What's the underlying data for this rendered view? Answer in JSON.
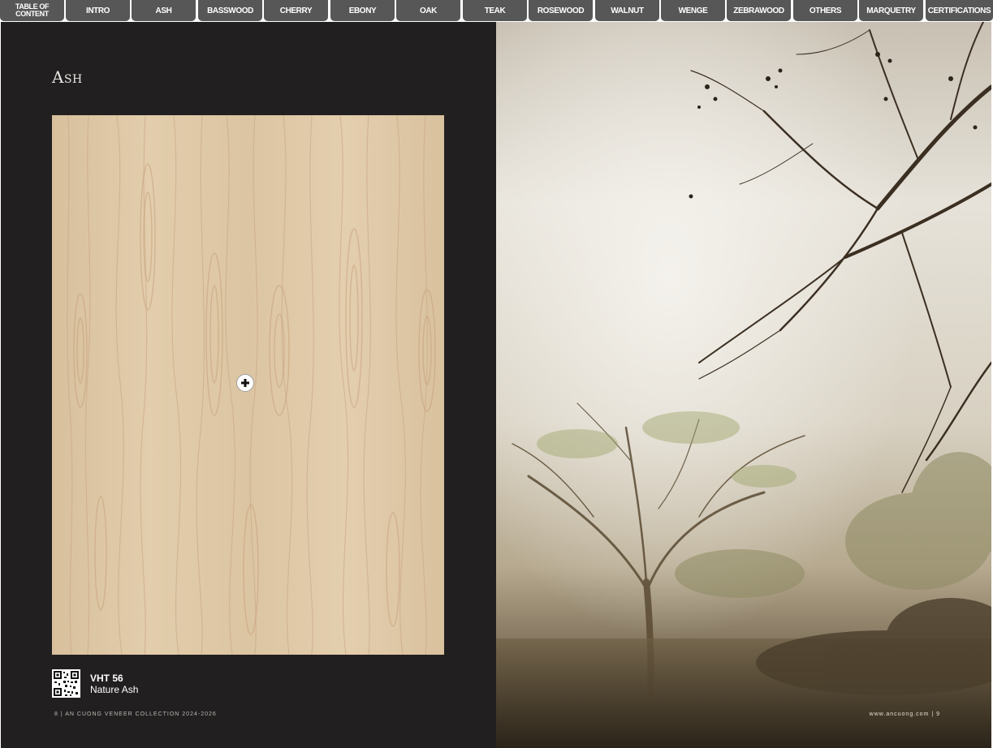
{
  "tabs": [
    {
      "label": "TABLE OF CONTENT"
    },
    {
      "label": "INTRO"
    },
    {
      "label": "ASH"
    },
    {
      "label": "BASSWOOD"
    },
    {
      "label": "CHERRY"
    },
    {
      "label": "EBONY"
    },
    {
      "label": "OAK"
    },
    {
      "label": "TEAK"
    },
    {
      "label": "ROSEWOOD"
    },
    {
      "label": "WALNUT"
    },
    {
      "label": "WENGE"
    },
    {
      "label": "ZEBRAWOOD"
    },
    {
      "label": "OTHERS"
    },
    {
      "label": "MARQUETRY"
    },
    {
      "label": "CERTIFICATIONS"
    }
  ],
  "left_page": {
    "section_title": "Ash",
    "product": {
      "code": "VHT 56",
      "name": "Nature Ash"
    },
    "footer": "8 | AN CUONG VENEER COLLECTION 2024-2026",
    "zoom_icon": "plus-icon",
    "qr_icon": "qr-code-icon"
  },
  "right_page": {
    "footer": "www.ancuong.com | 9",
    "photo": "misty-trees-photo"
  },
  "colors": {
    "tab_bg": "#575757",
    "page_dark": "#221f20",
    "veneer": "#ddc6a4"
  }
}
